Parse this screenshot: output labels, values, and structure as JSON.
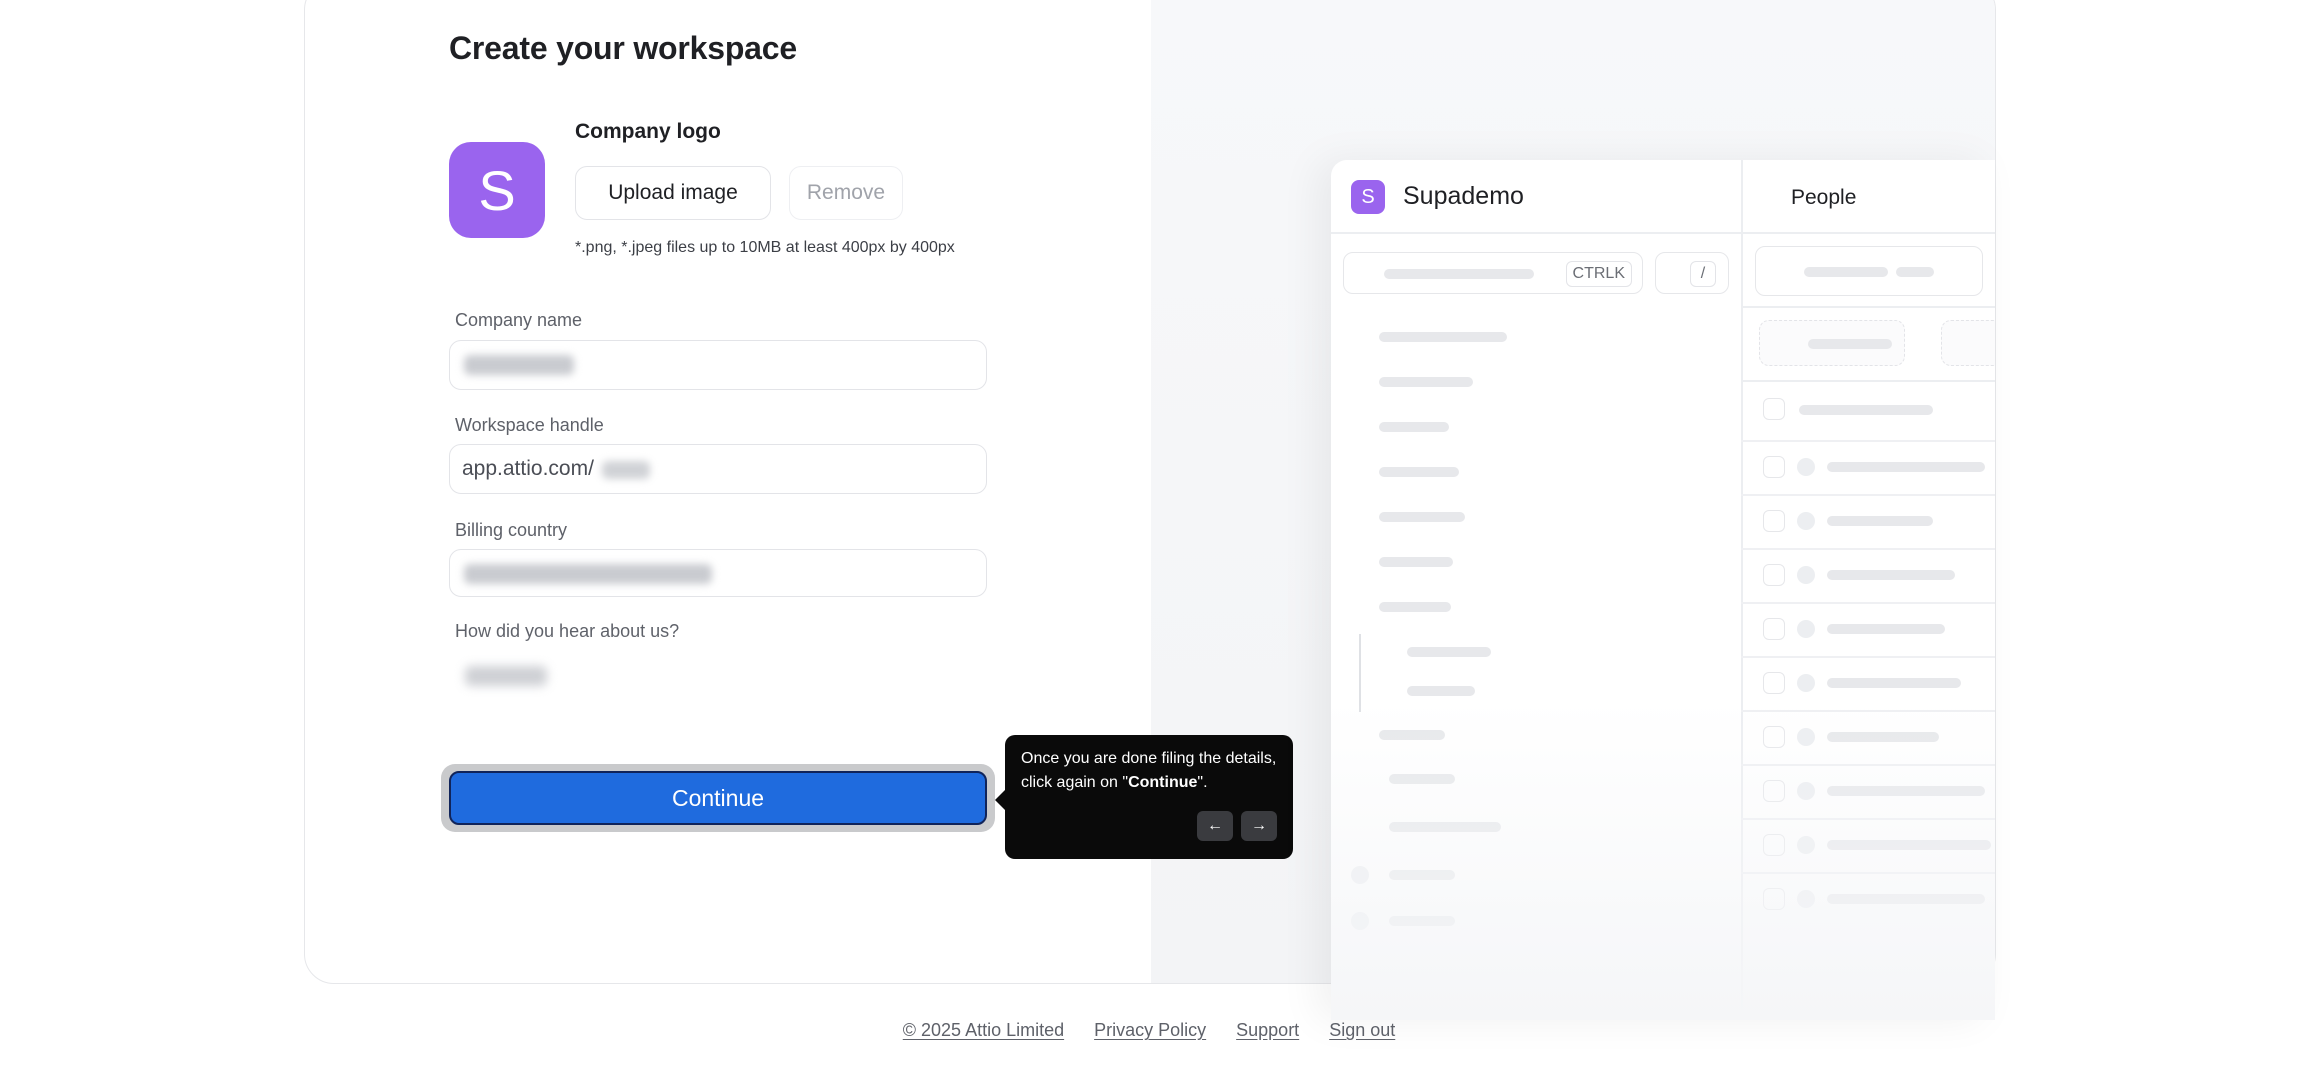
{
  "form": {
    "title": "Create your workspace",
    "logo_letter": "S",
    "logo_label": "Company logo",
    "upload_label": "Upload image",
    "remove_label": "Remove",
    "file_hint": "*.png, *.jpeg files up to 10MB at least 400px by 400px",
    "fields": [
      {
        "label": "Company name"
      },
      {
        "label": "Workspace handle",
        "prefix": "app.attio.com/"
      },
      {
        "label": "Billing country"
      },
      {
        "label": "How did you hear about us?"
      }
    ],
    "continue_label": "Continue"
  },
  "tooltip": {
    "text_before": "Once you are done filing the details, click again on \"",
    "text_bold": "Continue",
    "text_after": "\".",
    "prev_icon": "←",
    "next_icon": "→"
  },
  "preview": {
    "logo_letter": "S",
    "brand": "Supademo",
    "section": "People",
    "shortcut": "CTRLK",
    "slash": "/"
  },
  "footer": {
    "copyright": "© 2025 Attio Limited",
    "privacy": "Privacy Policy",
    "support": "Support",
    "signout": "Sign out"
  },
  "colors": {
    "accent": "#1f6bde",
    "logo": "#9a64ee"
  }
}
